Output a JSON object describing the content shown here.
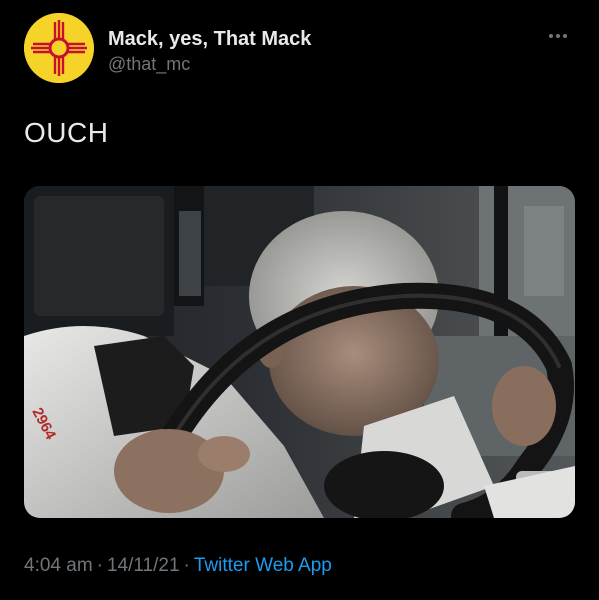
{
  "tweet": {
    "display_name": "Mack, yes, That Mack",
    "handle": "@that_mc",
    "text": "OUCH",
    "more_icon": "more-horizontal-icon",
    "avatar_icon": "zia-sun-symbol-icon",
    "media_jersey_text": "2964",
    "meta": {
      "time": "4:04 am",
      "separator": "·",
      "date": "14/11/21",
      "source": "Twitter Web App"
    }
  },
  "colors": {
    "background": "#000000",
    "primary_text": "#e7e9ea",
    "secondary_text": "#71767b",
    "accent": "#1d9bf0",
    "avatar_bg": "#f5d328",
    "avatar_symbol": "#c8102e"
  }
}
